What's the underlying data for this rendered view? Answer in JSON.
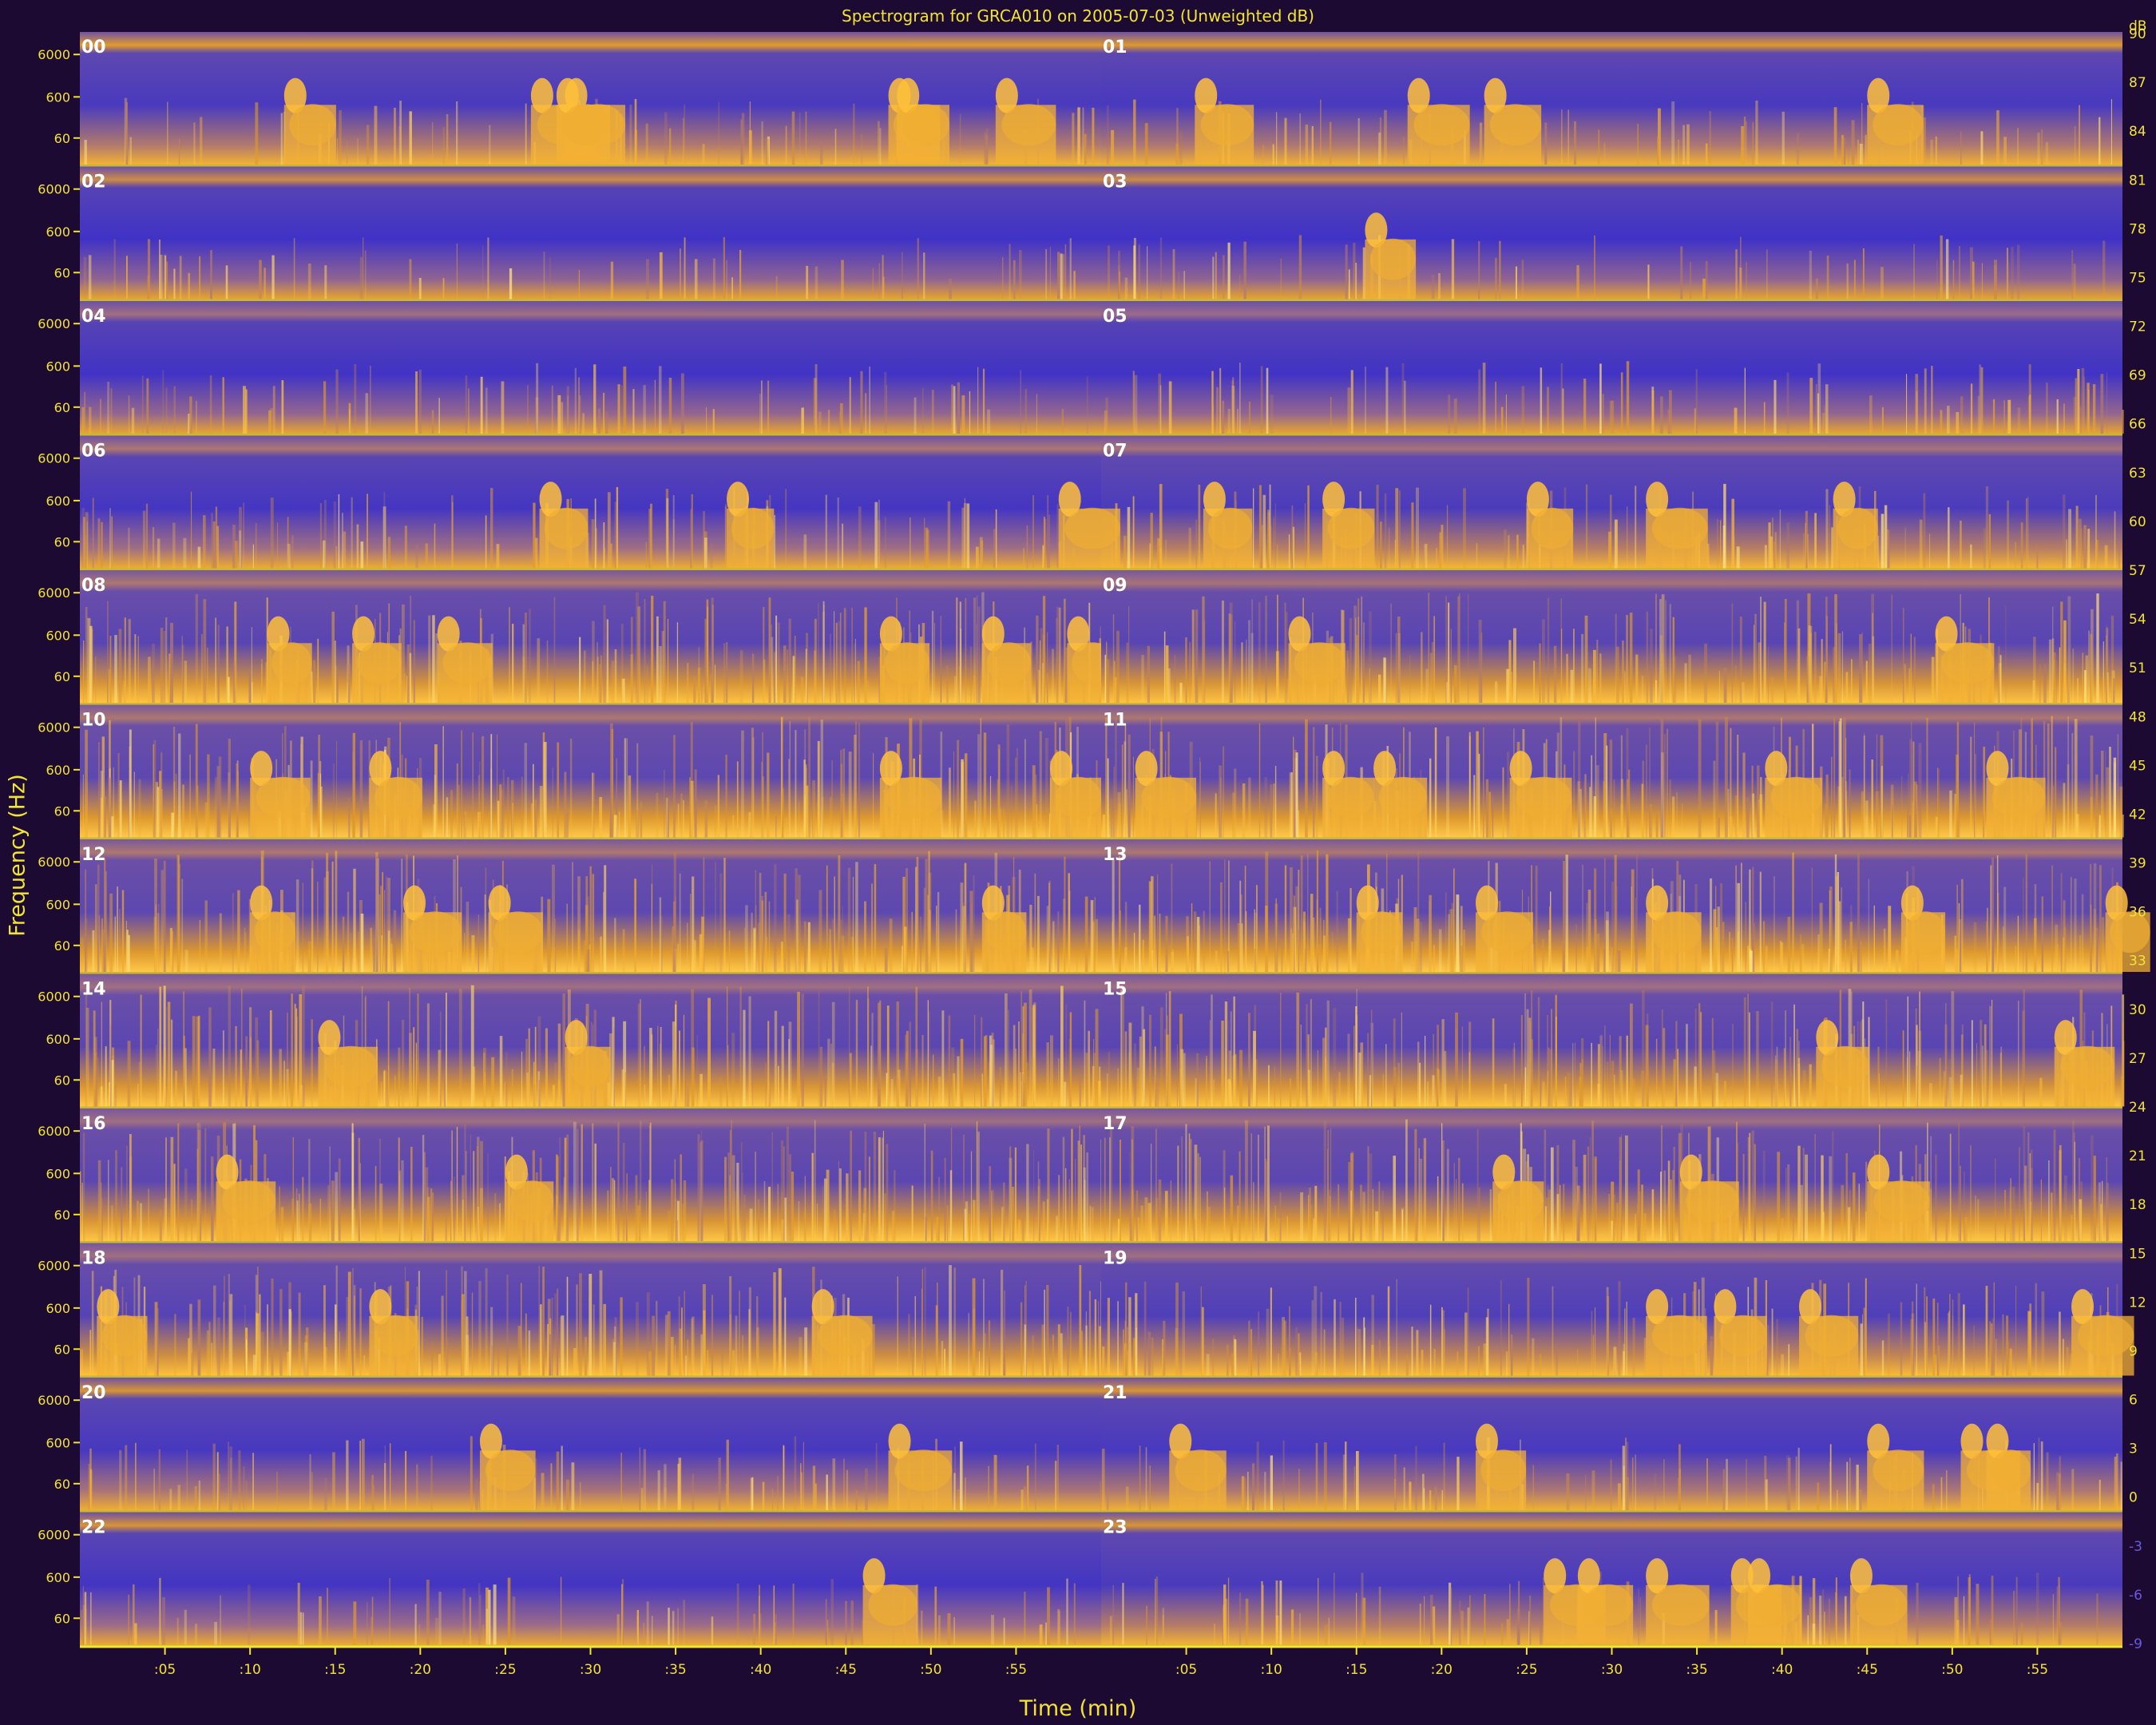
{
  "chart_data": {
    "type": "heatmap",
    "title": "Spectrogram for GRCA010 on 2005-07-03 (Unweighted dB)",
    "xlabel": "Time (min)",
    "ylabel": "Frequency (Hz)",
    "colorbar_unit": "dB",
    "colorbar_ticks": [
      90,
      87,
      84,
      81,
      78,
      75,
      72,
      69,
      66,
      63,
      60,
      57,
      54,
      51,
      48,
      45,
      42,
      39,
      36,
      33,
      30,
      27,
      24,
      21,
      18,
      15,
      12,
      9,
      6,
      3,
      0,
      -3,
      -6,
      -9
    ],
    "colorbar_range": [
      -9,
      90
    ],
    "colormap": [
      "#2a1fd9",
      "#5040b8",
      "#9a6a8a",
      "#e09a2a",
      "#ffc13a",
      "#fff2a0"
    ],
    "yticks": [
      "6000",
      "600",
      "60"
    ],
    "xticks": [
      ":05",
      ":10",
      ":15",
      ":20",
      ":25",
      ":30",
      ":35",
      ":40",
      ":45",
      ":50",
      ":55"
    ],
    "panels": [
      {
        "label": "00",
        "level": 0.38,
        "busy": 0.1,
        "line": 0.75,
        "bursts": [
          12,
          28.5,
          26.5,
          28,
          47.5,
          48,
          53.8
        ]
      },
      {
        "label": "01",
        "level": 0.36,
        "busy": 0.1,
        "line": 0.7,
        "bursts": [
          5.5,
          22.5,
          18,
          45
        ]
      },
      {
        "label": "02",
        "level": 0.22,
        "busy": 0.05,
        "line": 0.55,
        "bursts": []
      },
      {
        "label": "03",
        "level": 0.22,
        "busy": 0.06,
        "line": 0.55,
        "bursts": [
          15.5
        ]
      },
      {
        "label": "04",
        "level": 0.24,
        "busy": 0.15,
        "line": 0.2,
        "bursts": []
      },
      {
        "label": "05",
        "level": 0.24,
        "busy": 0.18,
        "line": 0.15,
        "bursts": []
      },
      {
        "label": "06",
        "level": 0.3,
        "busy": 0.3,
        "line": 0.3,
        "bursts": [
          27,
          38
        ]
      },
      {
        "label": "07",
        "level": 0.42,
        "busy": 0.35,
        "line": 0.25,
        "bursts": [
          -2.5,
          6,
          13,
          25,
          32,
          43
        ]
      },
      {
        "label": "08",
        "level": 0.58,
        "busy": 0.7,
        "line": 0.3,
        "bursts": [
          11,
          16,
          21,
          47,
          53,
          58
        ]
      },
      {
        "label": "09",
        "level": 0.58,
        "busy": 0.7,
        "line": 0.25,
        "bursts": [
          11,
          49
        ]
      },
      {
        "label": "10",
        "level": 0.62,
        "busy": 0.85,
        "line": 0.3,
        "bursts": [
          10,
          17,
          47,
          57
        ]
      },
      {
        "label": "11",
        "level": 0.62,
        "busy": 0.85,
        "line": 0.3,
        "bursts": [
          2,
          13,
          16,
          24,
          39,
          52
        ]
      },
      {
        "label": "12",
        "level": 0.62,
        "busy": 0.85,
        "line": 0.3,
        "bursts": [
          10,
          19,
          24,
          53
        ]
      },
      {
        "label": "13",
        "level": 0.62,
        "busy": 0.85,
        "line": 0.3,
        "bursts": [
          15,
          22,
          32,
          47,
          59
        ]
      },
      {
        "label": "14",
        "level": 0.6,
        "busy": 0.85,
        "line": 0.2,
        "bursts": [
          14,
          28.5
        ]
      },
      {
        "label": "15",
        "level": 0.58,
        "busy": 0.8,
        "line": 0.2,
        "bursts": [
          42,
          56
        ]
      },
      {
        "label": "16",
        "level": 0.6,
        "busy": 0.85,
        "line": 0.2,
        "bursts": [
          8,
          25
        ]
      },
      {
        "label": "17",
        "level": 0.6,
        "busy": 0.85,
        "line": 0.2,
        "bursts": [
          23,
          34,
          45
        ]
      },
      {
        "label": "18",
        "level": 0.55,
        "busy": 0.7,
        "line": 0.2,
        "bursts": [
          1,
          17,
          43
        ]
      },
      {
        "label": "19",
        "level": 0.48,
        "busy": 0.55,
        "line": 0.2,
        "bursts": [
          32,
          36,
          41,
          57
        ]
      },
      {
        "label": "20",
        "level": 0.34,
        "busy": 0.2,
        "line": 0.65,
        "bursts": [
          23.5,
          47.5
        ]
      },
      {
        "label": "21",
        "level": 0.36,
        "busy": 0.2,
        "line": 0.65,
        "bursts": [
          4,
          22,
          45,
          50.5,
          52
        ]
      },
      {
        "label": "22",
        "level": 0.28,
        "busy": 0.12,
        "line": 0.65,
        "bursts": [
          46
        ]
      },
      {
        "label": "23",
        "level": 0.4,
        "busy": 0.2,
        "line": 0.65,
        "bursts": [
          26,
          28,
          32,
          37,
          38,
          44
        ]
      }
    ]
  }
}
